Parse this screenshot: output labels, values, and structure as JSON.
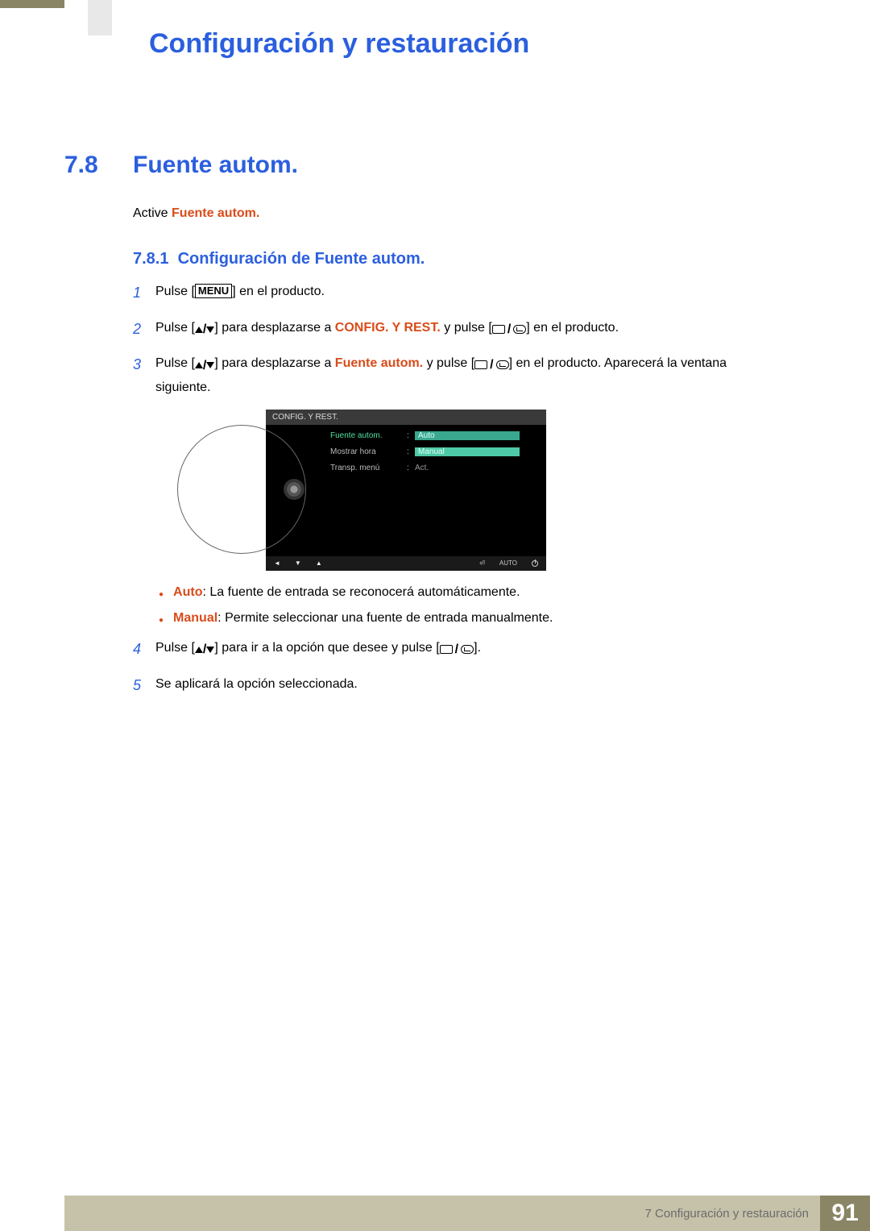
{
  "chapter_title": "Configuración y restauración",
  "section": {
    "num": "7.8",
    "title": "Fuente autom."
  },
  "active": {
    "prefix": "Active ",
    "feature": "Fuente autom."
  },
  "subsection": {
    "num": "7.8.1",
    "title": "Configuración de Fuente autom."
  },
  "steps": {
    "s1": {
      "num": "1",
      "a": "Pulse [",
      "menu": "MENU",
      "b": "] en el producto."
    },
    "s2": {
      "num": "2",
      "a": "Pulse [",
      "b": "] para desplazarse a ",
      "target": "CONFIG. Y REST.",
      "c": " y pulse [",
      "d": "] en el producto."
    },
    "s3": {
      "num": "3",
      "a": "Pulse [",
      "b": "] para desplazarse a ",
      "target": "Fuente autom.",
      "c": " y pulse [",
      "d": "] en el producto. Aparecerá la ventana siguiente."
    },
    "bullets": {
      "auto": {
        "label": "Auto",
        "text": ": La fuente de entrada se reconocerá automáticamente."
      },
      "manual": {
        "label": "Manual",
        "text": ": Permite seleccionar una fuente de entrada manualmente."
      }
    },
    "s4": {
      "num": "4",
      "a": "Pulse [",
      "b": "] para ir a la opción que desee y pulse [",
      "c": "]."
    },
    "s5": {
      "num": "5",
      "text": "Se aplicará la opción seleccionada."
    }
  },
  "osd": {
    "header": "CONFIG. Y REST.",
    "rows": {
      "r1": {
        "label": "Fuente autom.",
        "opt1": "Auto",
        "opt2": "Manual"
      },
      "r2": {
        "label": "Mostrar hora",
        "value": ""
      },
      "r3": {
        "label": "Transp. menú",
        "value": "Act."
      }
    },
    "nav_auto": "AUTO"
  },
  "footer": {
    "chapter_ref": "7 Configuración y restauración",
    "page": "91"
  }
}
